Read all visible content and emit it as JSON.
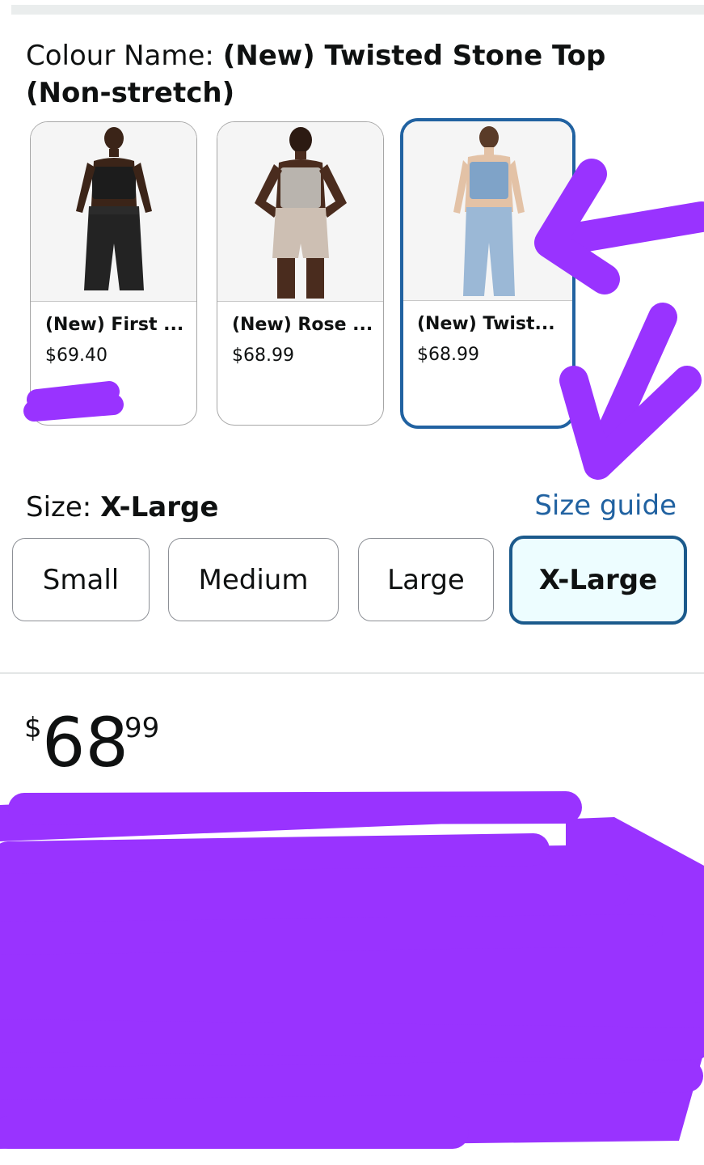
{
  "colour": {
    "label": "Colour Name: ",
    "value": "(New) Twisted Stone Top (Non-stretch)"
  },
  "swatches": [
    {
      "name": "(New) First ...",
      "price": "$69.40",
      "selected": false,
      "top_color": "#1c1c1c",
      "bottom_color": "#232323"
    },
    {
      "name": "(New) Rose ...",
      "price": "$68.99",
      "selected": false,
      "top_color": "#b9b4ae",
      "bottom_color": "#cdbfb3"
    },
    {
      "name": "(New) Twist...",
      "price": "$68.99",
      "selected": true,
      "top_color": "#7fa3c8",
      "bottom_color": "#9bb8d6"
    }
  ],
  "size": {
    "label": "Size: ",
    "value": "X-Large",
    "guide_link": "Size guide",
    "options": [
      "Small",
      "Medium",
      "Large",
      "X-Large"
    ],
    "selected": "X-Large"
  },
  "price": {
    "symbol": "$",
    "whole": "68",
    "fraction": "99"
  },
  "colors": {
    "link": "#2162a1",
    "selected_border": "#1b5a8c",
    "markup": "#9933ff"
  }
}
